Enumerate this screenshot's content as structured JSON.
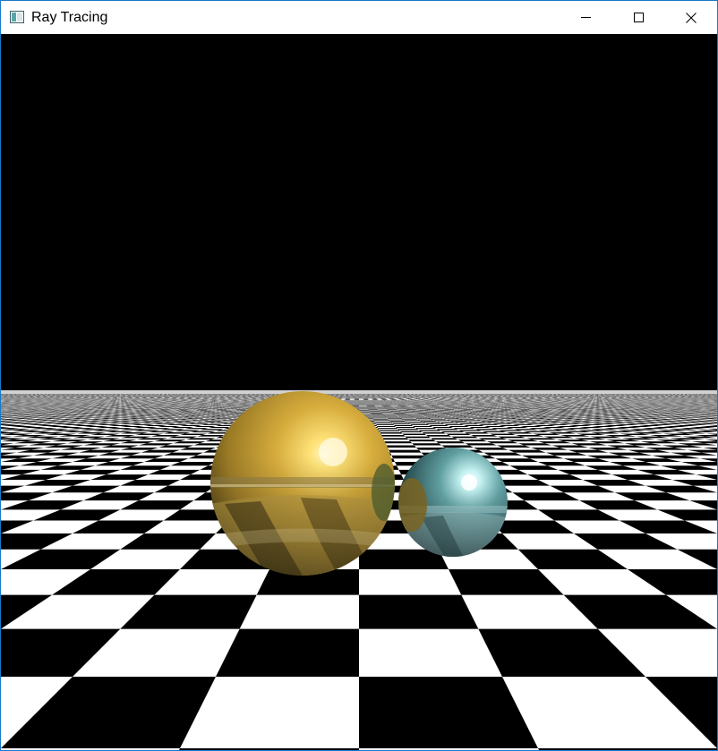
{
  "window": {
    "title": "Ray Tracing",
    "icon": "app-window-icon",
    "controls": {
      "minimize_icon": "minimize-icon",
      "maximize_icon": "maximize-icon",
      "close_icon": "close-icon"
    },
    "colors": {
      "frame_border": "#1979ca",
      "titlebar": "#ffffff",
      "close_hover": "#e81123"
    }
  },
  "scene": {
    "background": "#000000",
    "floor": {
      "pattern": "checkerboard",
      "colors": [
        "#ffffff",
        "#000000"
      ]
    },
    "spheres": [
      {
        "name": "gold-sphere",
        "color": "#c9a233",
        "highlight": "#fff2b0"
      },
      {
        "name": "teal-sphere",
        "color": "#4f8f93",
        "highlight": "#e8ffff"
      }
    ]
  }
}
